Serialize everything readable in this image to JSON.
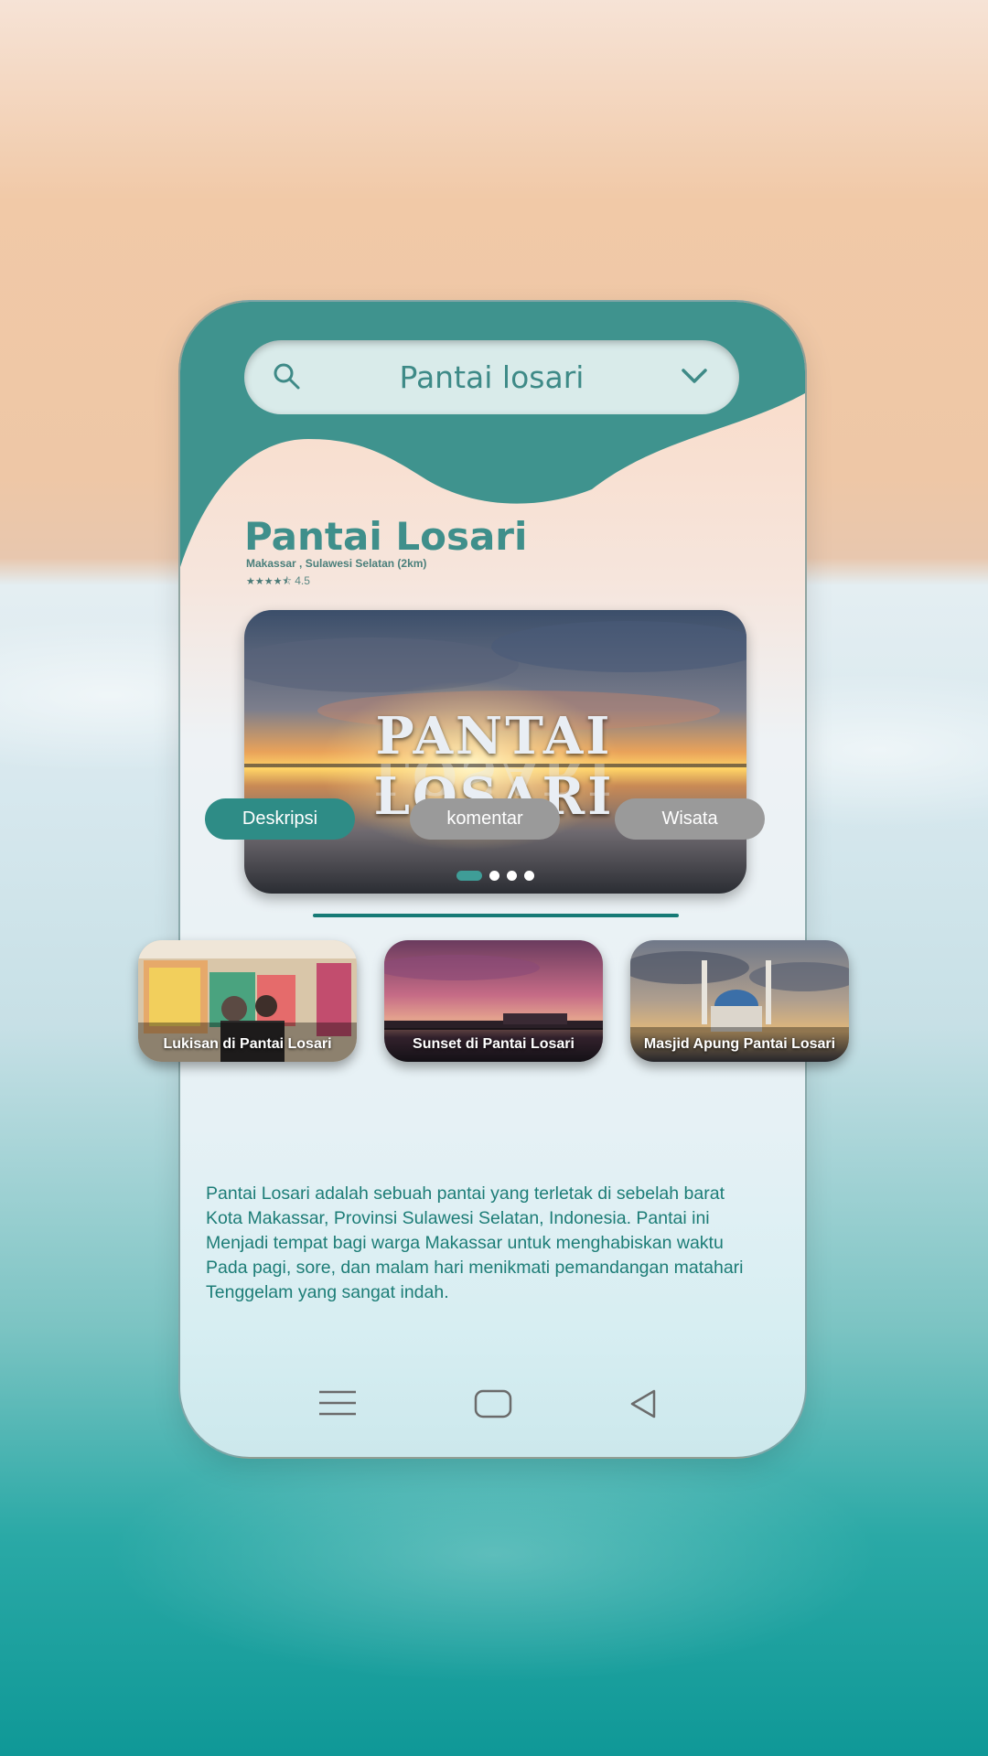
{
  "search": {
    "value": "Pantai losari",
    "icon": "search-icon",
    "dropdown_icon": "chevron-down-icon"
  },
  "place": {
    "title": "Pantai Losari",
    "location": "Makassar , Sulawesi Selatan (2km)",
    "rating_value": "4.5",
    "rating_stars": "★★★★⯪"
  },
  "hero": {
    "sign_text": "PANTAI LOSARI",
    "slides_total": 4,
    "active_slide": 1
  },
  "gallery": [
    {
      "label": "Lukisan di Pantai Losari"
    },
    {
      "label": "Sunset di Pantai Losari"
    },
    {
      "label": "Masjid Apung Pantai Losari"
    }
  ],
  "tabs": [
    {
      "label": "Deskripsi",
      "active": true
    },
    {
      "label": "komentar",
      "active": false
    },
    {
      "label": "Wisata",
      "active": false
    }
  ],
  "description_lines": [
    "Pantai Losari adalah sebuah pantai yang terletak di sebelah barat",
    "Kota Makassar, Provinsi Sulawesi Selatan, Indonesia. Pantai ini",
    "Menjadi tempat bagi warga Makassar untuk menghabiskan waktu",
    "Pada pagi, sore, dan malam hari menikmati pemandangan matahari",
    "Tenggelam yang sangat indah."
  ],
  "navbar": {
    "menu_icon": "menu-icon",
    "home_icon": "home-icon",
    "back_icon": "back-icon"
  },
  "colors": {
    "primary": "#3f938e",
    "tab_active": "#2e8c86",
    "tab_inactive": "#9a9a9a",
    "text_teal": "#1d7d77"
  }
}
